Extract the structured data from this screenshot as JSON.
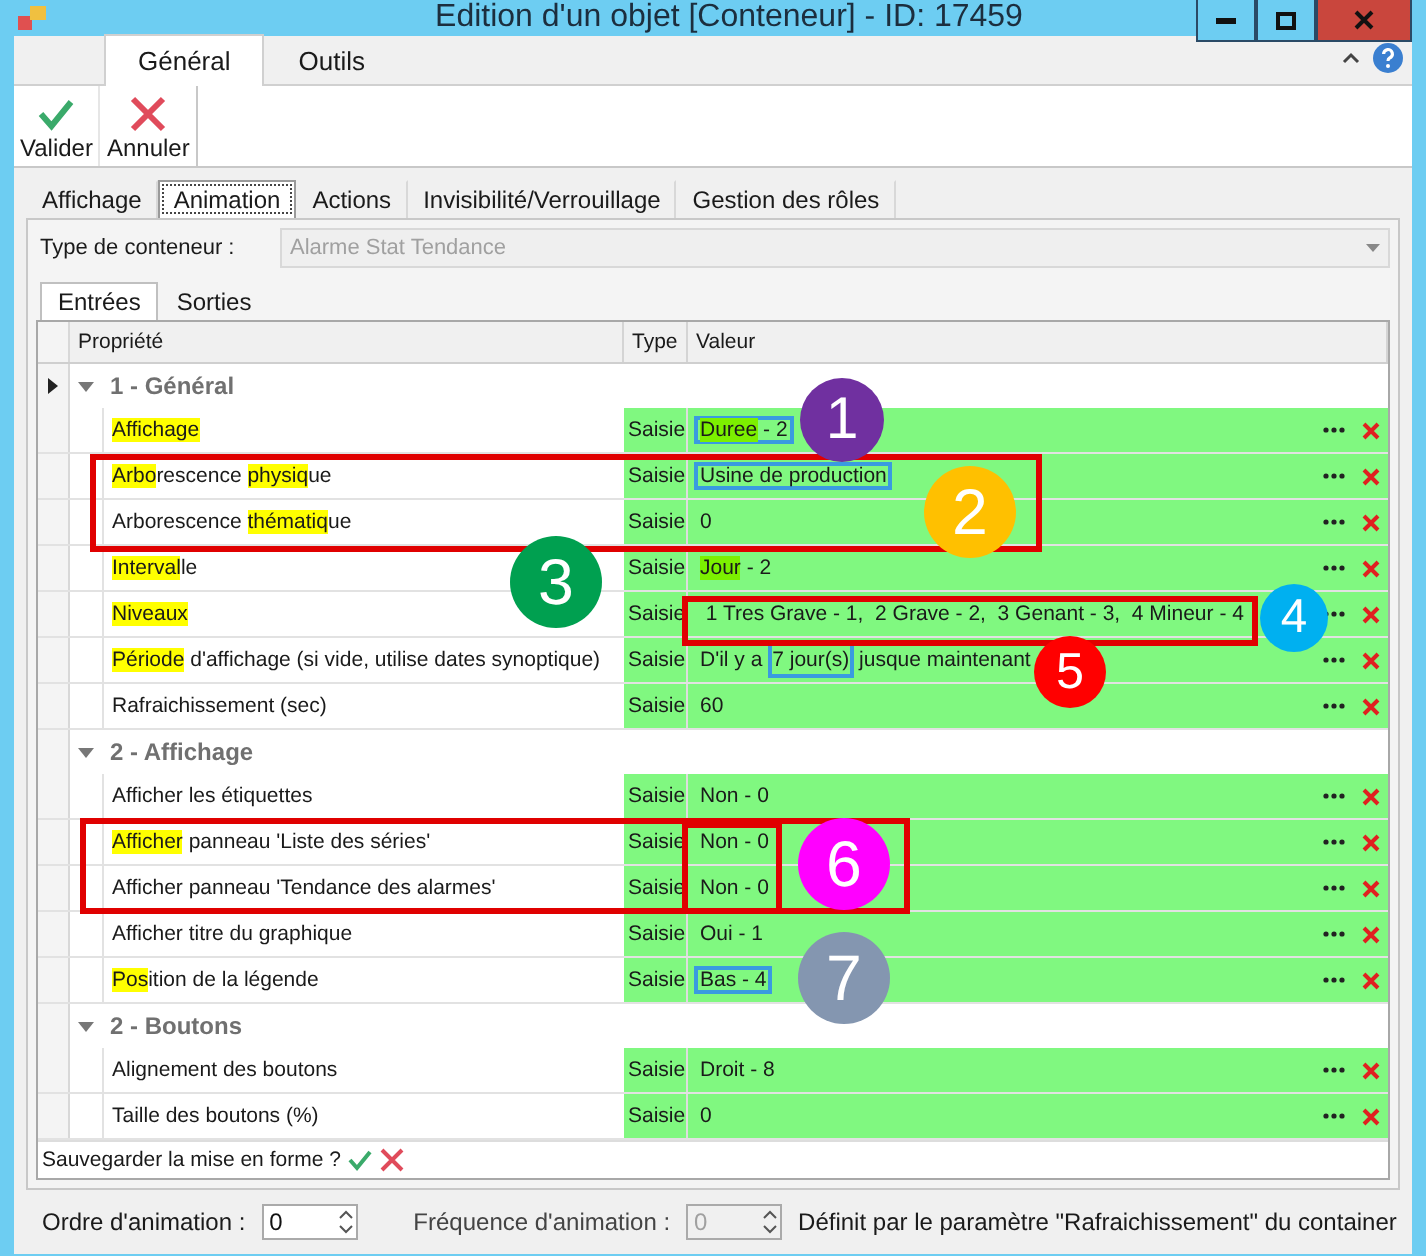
{
  "window": {
    "title": "Edition d'un objet [Conteneur] - ID: 17459"
  },
  "ribbon": {
    "tabs": [
      {
        "label": "Général",
        "selected": true
      },
      {
        "label": "Outils",
        "selected": false
      }
    ],
    "buttons": [
      {
        "label": "Valider",
        "kind": "check"
      },
      {
        "label": "Annuler",
        "kind": "cancel"
      }
    ]
  },
  "tabs": [
    {
      "label": "Affichage",
      "selected": false
    },
    {
      "label": "Animation",
      "selected": true
    },
    {
      "label": "Actions",
      "selected": false
    },
    {
      "label": "Invisibilité/Verrouillage",
      "selected": false
    },
    {
      "label": "Gestion des rôles",
      "selected": false
    }
  ],
  "container_type": {
    "label": "Type de conteneur :",
    "value": "Alarme Stat Tendance",
    "disabled": true
  },
  "subtabs": [
    {
      "label": "Entrées",
      "selected": true
    },
    {
      "label": "Sorties",
      "selected": false
    }
  ],
  "grid": {
    "columns": [
      "Propriété",
      "Type",
      "Valeur"
    ],
    "groups": [
      {
        "title": "1 - Général",
        "expanded": true,
        "current": true,
        "rows": [
          {
            "property": [
              {
                "text": "Affichage",
                "highlighted": true
              }
            ],
            "type": "Saisie",
            "value_boxed": true,
            "value": [
              {
                "text": "Duree",
                "highlighted": true,
                "boxed": false
              },
              {
                "text": " - 2",
                "highlighted": false,
                "boxed": false
              }
            ]
          },
          {
            "property": [
              {
                "text": "Arbo",
                "highlighted": true
              },
              {
                "text": "rescence ",
                "highlighted": false
              },
              {
                "text": "physiq",
                "highlighted": true
              },
              {
                "text": "ue",
                "highlighted": false
              }
            ],
            "type": "Saisie",
            "value_boxed": true,
            "value": [
              {
                "text": "Usine de production",
                "highlighted": false,
                "boxed": false
              }
            ]
          },
          {
            "property": [
              {
                "text": "Arborescence ",
                "highlighted": false
              },
              {
                "text": "thématiq",
                "highlighted": true
              },
              {
                "text": "ue",
                "highlighted": false
              }
            ],
            "type": "Saisie",
            "value_boxed": false,
            "value": [
              {
                "text": "0",
                "highlighted": false,
                "boxed": false
              }
            ]
          },
          {
            "property": [
              {
                "text": "Interval",
                "highlighted": true
              },
              {
                "text": "le",
                "highlighted": false
              }
            ],
            "type": "Saisie",
            "value_boxed": false,
            "value": [
              {
                "text": "Jour",
                "highlighted": true,
                "boxed": false
              },
              {
                "text": " - 2",
                "highlighted": false,
                "boxed": false
              }
            ]
          },
          {
            "property": [
              {
                "text": "Niveaux",
                "highlighted": true
              }
            ],
            "type": "Saisie",
            "value_boxed": false,
            "value": [
              {
                "text": " 1 Tres Grave - 1,  2 Grave - 2,  3 Genant - 3,  4 Mineur - 4",
                "highlighted": false,
                "boxed": false
              }
            ]
          },
          {
            "property": [
              {
                "text": "Période",
                "highlighted": true
              },
              {
                "text": " d'affichage (si vide, utilise dates synoptique)",
                "highlighted": false
              }
            ],
            "type": "Saisie",
            "value_boxed": false,
            "value": [
              {
                "text": "D'il y a ",
                "highlighted": false,
                "boxed": false
              },
              {
                "text": "7 jour(s)",
                "highlighted": false,
                "boxed": true
              },
              {
                "text": " jusque maintenant",
                "highlighted": false,
                "boxed": false
              }
            ]
          },
          {
            "property": [
              {
                "text": "Rafraichissement (sec)",
                "highlighted": false
              }
            ],
            "type": "Saisie",
            "value_boxed": false,
            "value": [
              {
                "text": "60",
                "highlighted": false,
                "boxed": false
              }
            ]
          }
        ]
      },
      {
        "title": "2 - Affichage",
        "expanded": true,
        "current": false,
        "rows": [
          {
            "property": [
              {
                "text": "Afficher les étiquettes",
                "highlighted": false
              }
            ],
            "type": "Saisie",
            "value_boxed": false,
            "value": [
              {
                "text": "Non - 0",
                "highlighted": false,
                "boxed": false
              }
            ]
          },
          {
            "property": [
              {
                "text": "Afficher",
                "highlighted": true
              },
              {
                "text": " panneau 'Liste des séries'",
                "highlighted": false
              }
            ],
            "type": "Saisie",
            "value_boxed": false,
            "value": [
              {
                "text": "Non - 0",
                "highlighted": false,
                "boxed": false
              }
            ]
          },
          {
            "property": [
              {
                "text": "Afficher panneau 'Tendance des alarmes'",
                "highlighted": false
              }
            ],
            "type": "Saisie",
            "value_boxed": false,
            "value": [
              {
                "text": "Non - 0",
                "highlighted": false,
                "boxed": false
              }
            ]
          },
          {
            "property": [
              {
                "text": "Afficher titre du graphique",
                "highlighted": false
              }
            ],
            "type": "Saisie",
            "value_boxed": false,
            "value": [
              {
                "text": "Oui - 1",
                "highlighted": false,
                "boxed": false
              }
            ]
          },
          {
            "property": [
              {
                "text": "Pos",
                "highlighted": true
              },
              {
                "text": "ition de la légende",
                "highlighted": false
              }
            ],
            "type": "Saisie",
            "value_boxed": true,
            "value": [
              {
                "text": "Bas - 4",
                "highlighted": false,
                "boxed": false
              }
            ]
          }
        ]
      },
      {
        "title": "2 - Boutons",
        "expanded": true,
        "current": false,
        "rows": [
          {
            "property": [
              {
                "text": "Alignement des boutons",
                "highlighted": false
              }
            ],
            "type": "Saisie",
            "value_boxed": false,
            "value": [
              {
                "text": "Droit - 8",
                "highlighted": false,
                "boxed": false
              }
            ]
          },
          {
            "property": [
              {
                "text": "Taille des boutons (%)",
                "highlighted": false
              }
            ],
            "type": "Saisie",
            "value_boxed": false,
            "value": [
              {
                "text": "0",
                "highlighted": false,
                "boxed": false
              }
            ]
          }
        ]
      }
    ]
  },
  "footer": {
    "prompt": "Sauvegarder la mise en forme ?"
  },
  "bottom": {
    "order_label": "Ordre d'animation :",
    "order_value": "0",
    "frequency_label": "Fréquence d'animation :",
    "frequency_value": "0",
    "frequency_disabled": true,
    "note": "Définit par le paramètre \"Rafraichissement\" du container"
  },
  "callouts": [
    {
      "label": "1",
      "color": "#7030a0"
    },
    {
      "label": "2",
      "color": "#ffc000"
    },
    {
      "label": "3",
      "color": "#00a050"
    },
    {
      "label": "4",
      "color": "#00b0f0"
    },
    {
      "label": "5",
      "color": "#ff0000"
    },
    {
      "label": "6",
      "color": "#ff00ff"
    },
    {
      "label": "7",
      "color": "#8496b0"
    }
  ]
}
